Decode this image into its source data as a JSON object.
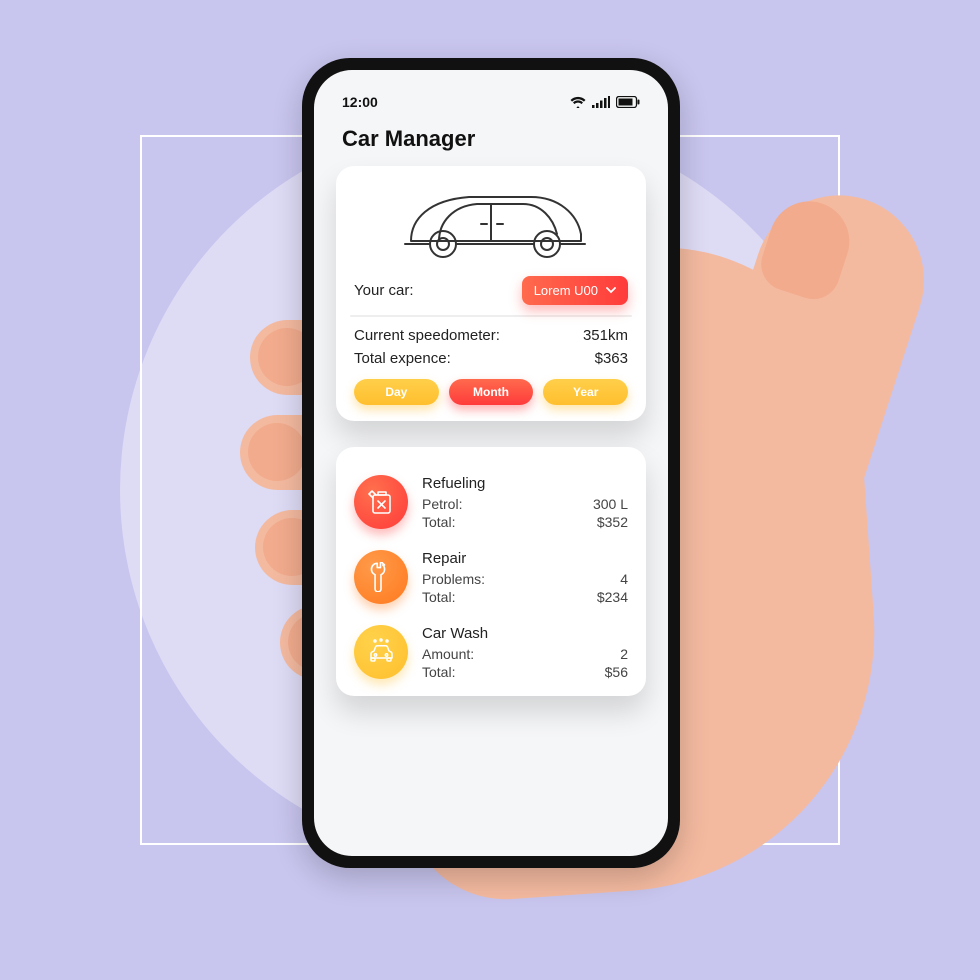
{
  "status": {
    "time": "12:00"
  },
  "app": {
    "title": "Car Manager"
  },
  "car_card": {
    "your_car_label": "Your car:",
    "selected_car": "Lorem U00",
    "speedometer_label": "Current speedometer:",
    "speedometer_value": "351km",
    "expense_label": "Total expence:",
    "expense_value": "$363",
    "periods": {
      "day": "Day",
      "month": "Month",
      "year": "Year"
    }
  },
  "categories": {
    "refueling": {
      "title": "Refueling",
      "line1_label": "Petrol:",
      "line1_value": "300 L",
      "line2_label": "Total:",
      "line2_value": "$352"
    },
    "repair": {
      "title": "Repair",
      "line1_label": "Problems:",
      "line1_value": "4",
      "line2_label": "Total:",
      "line2_value": "$234"
    },
    "carwash": {
      "title": "Car Wash",
      "line1_label": "Amount:",
      "line1_value": "2",
      "line2_label": "Total:",
      "line2_value": "$56"
    }
  }
}
